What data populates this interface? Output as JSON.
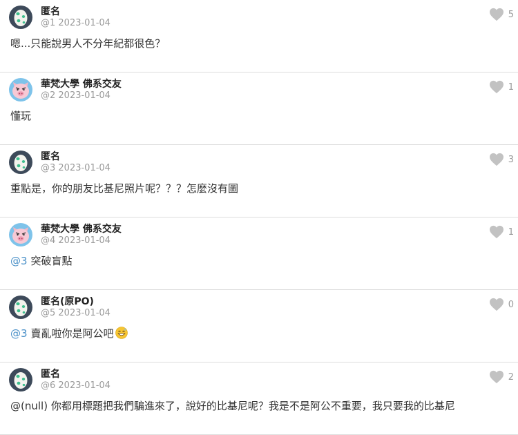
{
  "comments": [
    {
      "author": "匿名",
      "avatar": "egg",
      "meta": "@1 2023-01-04",
      "likes": "5",
      "mention": "",
      "text": "嗯...只能說男人不分年紀都很色？",
      "emoji": ""
    },
    {
      "author": "華梵大學 佛系交友",
      "avatar": "pig",
      "meta": "@2 2023-01-04",
      "likes": "1",
      "mention": "",
      "text": "懂玩",
      "emoji": ""
    },
    {
      "author": "匿名",
      "avatar": "egg",
      "meta": "@3 2023-01-04",
      "likes": "3",
      "mention": "",
      "text": "重點是，你的朋友比基尼照片呢？？？怎麼沒有圖",
      "emoji": ""
    },
    {
      "author": "華梵大學 佛系交友",
      "avatar": "pig",
      "meta": "@4 2023-01-04",
      "likes": "1",
      "mention": "@3",
      "text": "突破盲點",
      "emoji": ""
    },
    {
      "author": "匿名(原PO)",
      "avatar": "egg",
      "meta": "@5 2023-01-04",
      "likes": "0",
      "mention": "@3",
      "text": "賣亂啦你是阿公吧",
      "emoji": "grin-sweat-emoji"
    },
    {
      "author": "匿名",
      "avatar": "egg",
      "meta": "@6 2023-01-04",
      "likes": "2",
      "mention": "",
      "text": "@(null) 你都用標題把我們騙進來了，說好的比基尼呢？我是不是阿公不重要，我只要我的比基尼",
      "emoji": ""
    }
  ]
}
